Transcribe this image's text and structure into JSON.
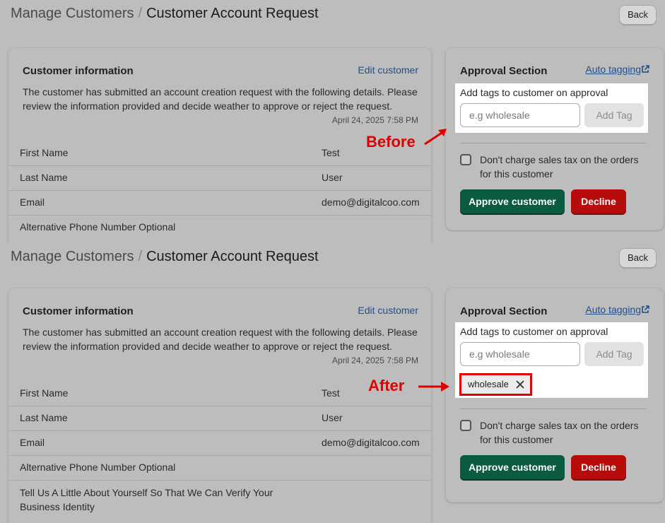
{
  "header": {
    "parent": "Manage Customers",
    "separator": "/",
    "current": "Customer Account Request",
    "back_label": "Back"
  },
  "customer_info": {
    "title": "Customer information",
    "edit_label": "Edit customer",
    "description": "The customer has submitted an account creation request with the following details. Please review the information provided and decide weather to approve or reject the request.",
    "date": "April 24, 2025 7:58 PM",
    "rows": [
      {
        "label": "First Name",
        "value": "Test"
      },
      {
        "label": "Last Name",
        "value": "User"
      },
      {
        "label": "Email",
        "value": "demo@digitalcoo.com"
      },
      {
        "label": "Alternative Phone Number Optional",
        "value": ""
      },
      {
        "label": "Tell Us A Little About Yourself So That We Can Verify Your Business Identity",
        "value": ""
      }
    ]
  },
  "approval": {
    "title": "Approval Section",
    "auto_tagging_label": "Auto tagging",
    "tags_label": "Add tags to customer on approval",
    "tag_placeholder": "e.g wholesale",
    "add_tag_label": "Add Tag",
    "added_tag": "wholesale",
    "tax_label": "Don't charge sales tax on the orders for this customer",
    "approve_label": "Approve customer",
    "decline_label": "Decline"
  },
  "annotations": {
    "before": "Before",
    "after": "After",
    "color": "#e00000"
  },
  "icons": [
    "external-link-icon",
    "close-icon",
    "arrow-icon"
  ]
}
